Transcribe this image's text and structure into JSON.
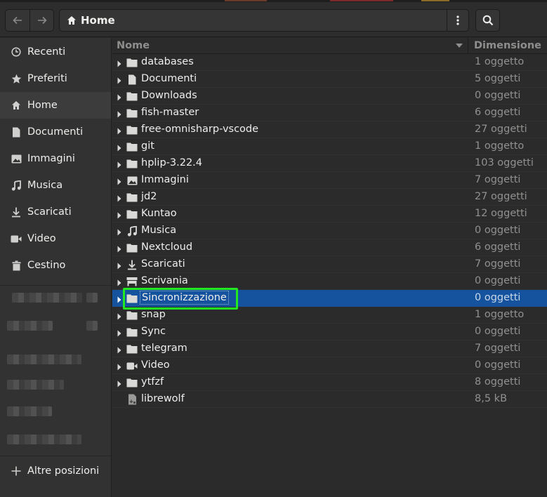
{
  "header": {
    "location": "Home"
  },
  "sidebar": {
    "items": [
      {
        "label": "Recenti",
        "icon": "clock-icon"
      },
      {
        "label": "Preferiti",
        "icon": "star-icon"
      },
      {
        "label": "Home",
        "icon": "home-icon"
      },
      {
        "label": "Documenti",
        "icon": "document-icon"
      },
      {
        "label": "Immagini",
        "icon": "image-icon"
      },
      {
        "label": "Musica",
        "icon": "music-icon"
      },
      {
        "label": "Scaricati",
        "icon": "download-icon"
      },
      {
        "label": "Video",
        "icon": "video-icon"
      },
      {
        "label": "Cestino",
        "icon": "trash-icon"
      }
    ],
    "other_locations": "Altre posizioni"
  },
  "columns": {
    "name": "Nome",
    "size": "Dimensione"
  },
  "files": [
    {
      "name": "databases",
      "size": "1 oggetto",
      "icon": "folder-icon"
    },
    {
      "name": "Documenti",
      "size": "5 oggetti",
      "icon": "document-icon"
    },
    {
      "name": "Downloads",
      "size": "0 oggetti",
      "icon": "folder-icon"
    },
    {
      "name": "fish-master",
      "size": "6 oggetti",
      "icon": "folder-icon"
    },
    {
      "name": "free-omnisharp-vscode",
      "size": "27 oggetti",
      "icon": "folder-icon"
    },
    {
      "name": "git",
      "size": "1 oggetto",
      "icon": "folder-icon"
    },
    {
      "name": "hplip-3.22.4",
      "size": "103 oggetti",
      "icon": "folder-icon"
    },
    {
      "name": "Immagini",
      "size": "7 oggetti",
      "icon": "image-icon"
    },
    {
      "name": "jd2",
      "size": "27 oggetti",
      "icon": "folder-icon"
    },
    {
      "name": "Kuntao",
      "size": "12 oggetti",
      "icon": "folder-icon"
    },
    {
      "name": "Musica",
      "size": "0 oggetti",
      "icon": "music-icon"
    },
    {
      "name": "Nextcloud",
      "size": "6 oggetti",
      "icon": "folder-icon"
    },
    {
      "name": "Scaricati",
      "size": "7 oggetti",
      "icon": "download-icon"
    },
    {
      "name": "Scrivania",
      "size": "0 oggetti",
      "icon": "desktop-icon"
    },
    {
      "name": "Sincronizzazione",
      "size": "0 oggetti",
      "icon": "folder-icon"
    },
    {
      "name": "snap",
      "size": "1 oggetto",
      "icon": "folder-icon"
    },
    {
      "name": "Sync",
      "size": "0 oggetti",
      "icon": "folder-icon"
    },
    {
      "name": "telegram",
      "size": "7 oggetti",
      "icon": "folder-icon"
    },
    {
      "name": "Video",
      "size": "0 oggetti",
      "icon": "video-icon"
    },
    {
      "name": "ytfzf",
      "size": "8 oggetti",
      "icon": "folder-icon"
    },
    {
      "name": "librewolf",
      "size": "8,5  kB",
      "icon": "file-icon"
    }
  ],
  "colors": {
    "selection": "#15539e",
    "highlight_box": "#22e822",
    "background": "#2b2b2b",
    "sidebar": "#323232"
  }
}
